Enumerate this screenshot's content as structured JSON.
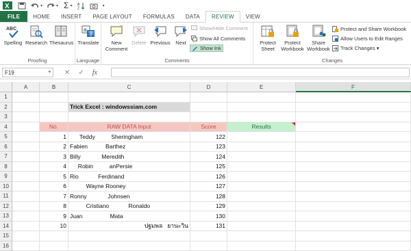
{
  "titlebar": {
    "excel_icon": "excel-icon",
    "undo_icon": "undo-icon",
    "redo_icon": "redo-icon",
    "autosum": "Σ"
  },
  "tabs": [
    {
      "label": "FILE"
    },
    {
      "label": "HOME"
    },
    {
      "label": "INSERT"
    },
    {
      "label": "PAGE LAYOUT"
    },
    {
      "label": "FORMULAS"
    },
    {
      "label": "DATA"
    },
    {
      "label": "REVIEW"
    },
    {
      "label": "VIEW"
    }
  ],
  "ribbon": {
    "proofing": {
      "label": "Proofing",
      "spelling": "Spelling",
      "research": "Research",
      "thesaurus": "Thesaurus"
    },
    "language": {
      "label": "Language",
      "translate": "Translate"
    },
    "comments": {
      "label": "Comments",
      "new_comment_1": "New",
      "new_comment_2": "Comment",
      "delete": "Delete",
      "previous": "Previous",
      "next": "Next",
      "show_hide": "Show/Hide Comment",
      "show_all": "Show All Comments",
      "show_ink": "Show Ink"
    },
    "changes": {
      "label": "Changes",
      "protect_sheet_1": "Protect",
      "protect_sheet_2": "Sheet",
      "protect_wb_1": "Protect",
      "protect_wb_2": "Workbook",
      "share_wb_1": "Share",
      "share_wb_2": "Workbook",
      "protect_share": "Protect and Share Workbook",
      "allow_users": "Allow Users to Edit Ranges",
      "track_changes": "Track Changes ▾"
    }
  },
  "formula_bar": {
    "name_box": "F19",
    "cancel": "✕",
    "enter": "✓",
    "fx": "fx",
    "value": ""
  },
  "columns": [
    "A",
    "B",
    "C",
    "D",
    "E",
    "F"
  ],
  "rows": [
    "1",
    "2",
    "3",
    "4",
    "5",
    "6",
    "7",
    "8",
    "9",
    "10",
    "11",
    "12",
    "13",
    "14",
    "15",
    "16"
  ],
  "sheet": {
    "title": "Trick Excel : windowssiam.com",
    "header_no": "No.",
    "header_raw": "RAW DATA Input",
    "header_score": "Score",
    "header_results": "Results",
    "records": [
      {
        "no": "1",
        "raw": "      Teddy          Sheringham",
        "score": "122"
      },
      {
        "no": "2",
        "raw": "Fabien           Barthez",
        "score": "123"
      },
      {
        "no": "3",
        "raw": "Billy             Meredith",
        "score": "124"
      },
      {
        "no": "4",
        "raw": "     Robin          anPersie",
        "score": "125"
      },
      {
        "no": "5",
        "raw": "Rio            Ferdinand",
        "score": "126"
      },
      {
        "no": "6",
        "raw": "          Wayne Rooney",
        "score": "127"
      },
      {
        "no": "7",
        "raw": "Ronny             Johnsen",
        "score": "128"
      },
      {
        "no": "8",
        "raw": "          Cristiano            Ronaldo",
        "score": "129"
      },
      {
        "no": "9",
        "raw": "Juan                 Mata",
        "score": "130"
      },
      {
        "no": "10",
        "raw": "ปฐมพล   ยานะวิน",
        "score": "131"
      }
    ]
  },
  "colors": {
    "excel_green": "#217346",
    "header_pink": "#f4c7c3",
    "header_green": "#c6efce",
    "title_gray": "#d9d9d9"
  }
}
